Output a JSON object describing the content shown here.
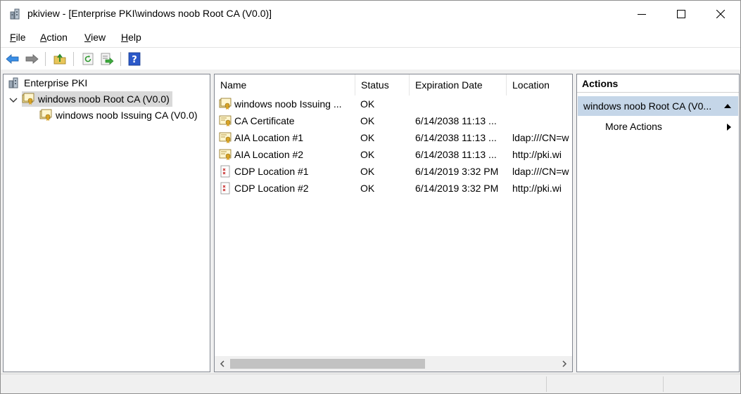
{
  "window": {
    "title": "pkiview - [Enterprise PKI\\windows noob Root CA (V0.0)]"
  },
  "menu": {
    "file": {
      "accel": "F",
      "rest": "ile"
    },
    "action": {
      "accel": "A",
      "rest": "ction"
    },
    "view": {
      "accel": "V",
      "rest": "iew"
    },
    "help": {
      "accel": "H",
      "rest": "elp"
    }
  },
  "toolbar": {
    "icons": [
      "back-arrow-icon",
      "forward-arrow-icon",
      "up-folder-icon",
      "refresh-icon",
      "export-list-icon",
      "help-icon"
    ]
  },
  "tree": {
    "root": "Enterprise PKI",
    "selected": "windows noob Root CA (V0.0)",
    "child": "windows noob Issuing CA (V0.0)"
  },
  "list": {
    "columns": [
      "Name",
      "Status",
      "Expiration Date",
      "Location"
    ],
    "rows": [
      {
        "name": "windows noob Issuing ...",
        "status": "OK",
        "expiration": "",
        "location": "",
        "icon": "ca-icon"
      },
      {
        "name": "CA Certificate",
        "status": "OK",
        "expiration": "6/14/2038 11:13 ...",
        "location": "",
        "icon": "certificate-icon"
      },
      {
        "name": "AIA Location #1",
        "status": "OK",
        "expiration": "6/14/2038 11:13 ...",
        "location": "ldap:///CN=w",
        "icon": "certificate-icon"
      },
      {
        "name": "AIA Location #2",
        "status": "OK",
        "expiration": "6/14/2038 11:13 ...",
        "location": "http://pki.wi",
        "icon": "certificate-icon"
      },
      {
        "name": "CDP Location #1",
        "status": "OK",
        "expiration": "6/14/2019 3:32 PM",
        "location": "ldap:///CN=w",
        "icon": "crl-icon"
      },
      {
        "name": "CDP Location #2",
        "status": "OK",
        "expiration": "6/14/2019 3:32 PM",
        "location": "http://pki.wi",
        "icon": "crl-icon"
      }
    ]
  },
  "actions": {
    "header": "Actions",
    "section": "windows noob Root CA (V0...",
    "more": "More Actions"
  },
  "colors": {
    "selection": "#d9d9d9",
    "actions_section": "#c5d6e8",
    "help_blue": "#2b58c9"
  }
}
